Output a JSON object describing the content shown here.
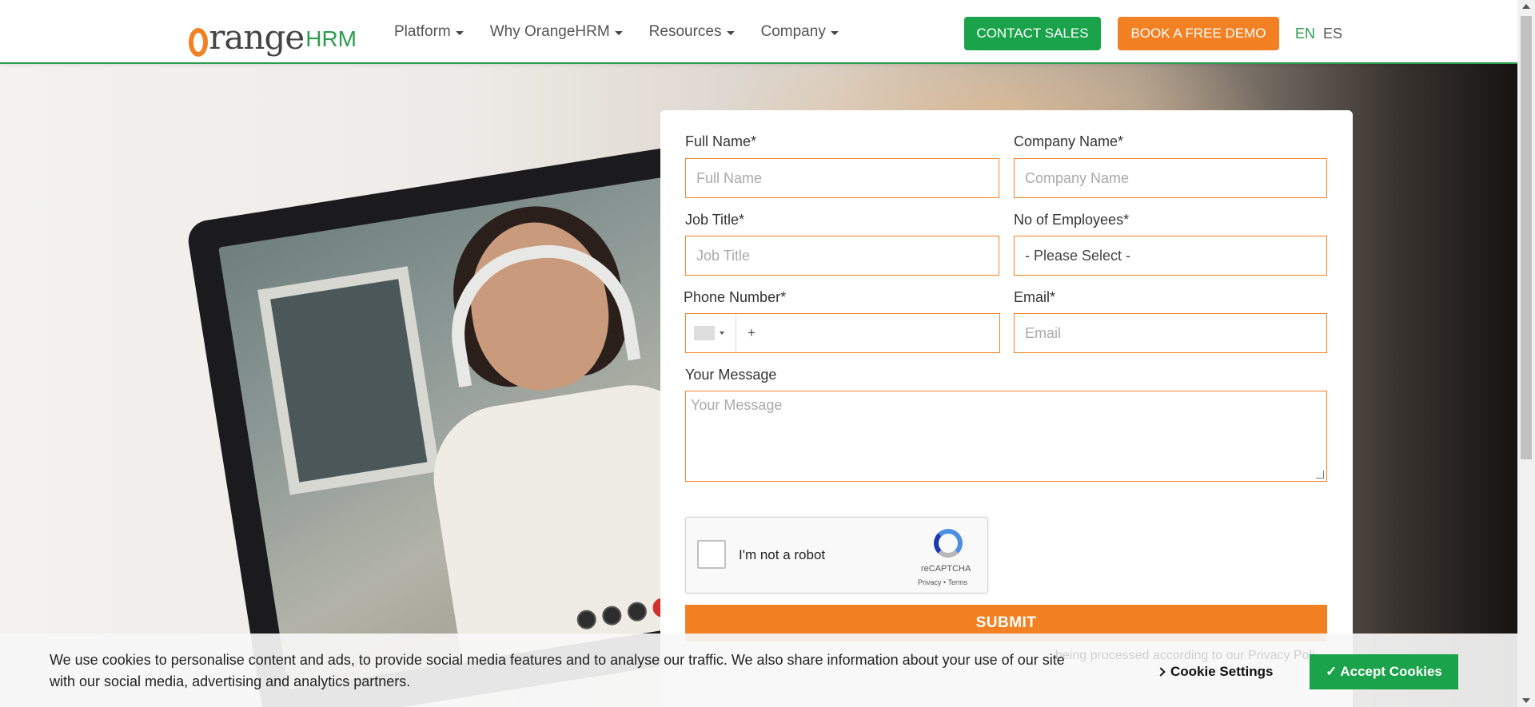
{
  "header": {
    "logo_main": "range",
    "logo_suffix": "HRM",
    "nav": [
      {
        "label": "Platform"
      },
      {
        "label": "Why OrangeHRM"
      },
      {
        "label": "Resources"
      },
      {
        "label": "Company"
      }
    ],
    "contact_sales": "CONTACT SALES",
    "book_demo": "BOOK A FREE DEMO",
    "lang_en": "EN",
    "lang_es": "ES"
  },
  "form": {
    "full_name_label": "Full Name*",
    "full_name_placeholder": "Full Name",
    "company_label": "Company Name*",
    "company_placeholder": "Company Name",
    "job_title_label": "Job Title*",
    "job_title_placeholder": "Job Title",
    "employees_label": "No of Employees*",
    "employees_selected": "- Please Select -",
    "phone_label": "Phone Number*",
    "phone_prefix": "+",
    "email_label": "Email*",
    "email_placeholder": "Email",
    "message_label": "Your Message",
    "message_placeholder": "Your Message",
    "submit": "SUBMIT"
  },
  "recaptcha": {
    "label": "I'm not a robot",
    "brand": "reCAPTCHA",
    "terms": "Privacy • Terms"
  },
  "cookie": {
    "text": "We use cookies to personalise content and ads, to provide social media features and to analyse our traffic. We also share information about your use of our site with our social media, advertising and analytics partners.",
    "behind_text": "being processed according to our Privacy Poli",
    "settings": "Cookie Settings",
    "accept": "Accept Cookies",
    "accept_icon": "✓"
  },
  "colors": {
    "brand_green": "#1aa34a",
    "brand_orange": "#f28123"
  }
}
